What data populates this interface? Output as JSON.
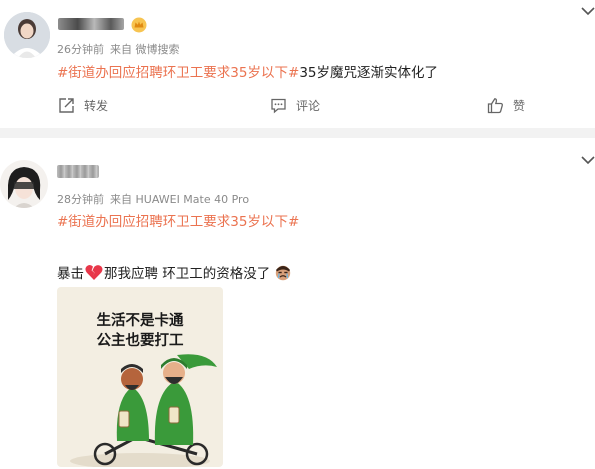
{
  "post1": {
    "time": "26分钟前",
    "source": "来自 微博搜索",
    "topic": "#街道办回应招聘环卫工要求35岁以下#",
    "text": "35岁魔咒逐渐实体化了",
    "actions": {
      "repost": "转发",
      "comment": "评论",
      "like": "赞"
    }
  },
  "post2": {
    "time": "28分钟前",
    "source": "来自 HUAWEI Mate 40 Pro",
    "topic": "#街道办回应招聘环卫工要求35岁以下#",
    "body_prefix": "暴击",
    "body_middle": "那我应聘 环卫工的资格没了",
    "image": {
      "line1": "生活不是卡通",
      "line2": "公主也要打工"
    }
  },
  "colors": {
    "topic": "#eb7350",
    "meta": "#8a8a8a",
    "divider": "#f2f2f2",
    "badge": "#f5a623",
    "card": "#f3eee2",
    "character": "#3a9a3a"
  }
}
